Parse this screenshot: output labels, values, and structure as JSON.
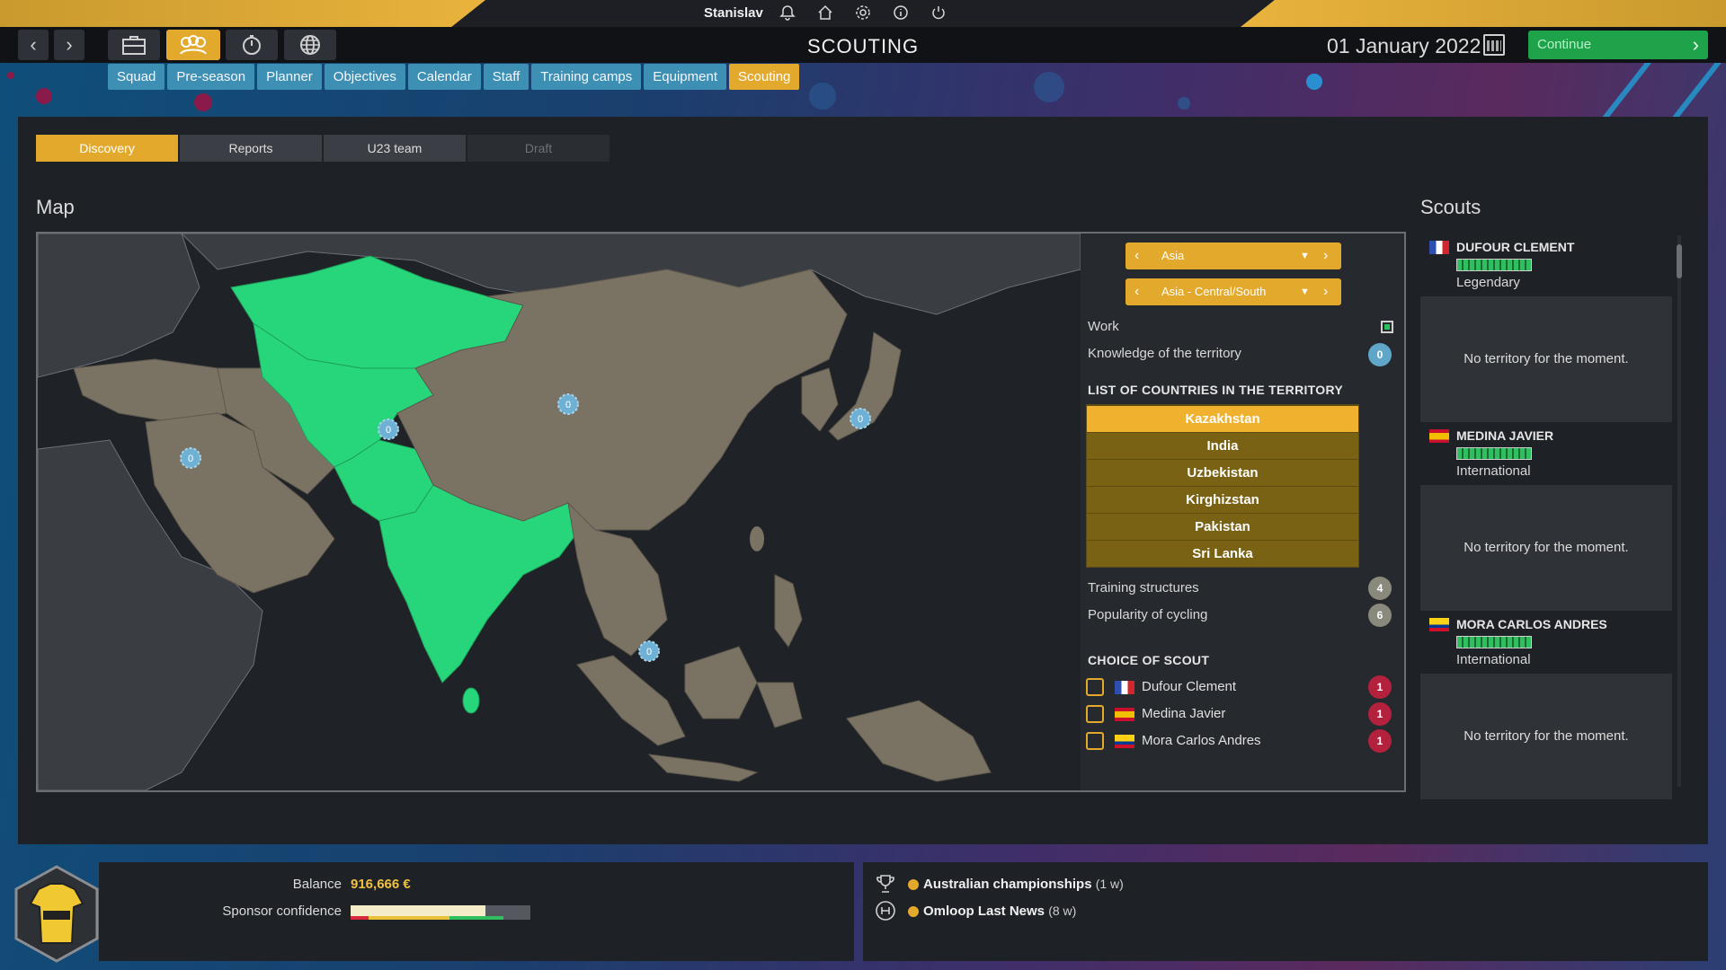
{
  "topbar": {
    "username": "Stanislav",
    "icons": [
      "bell-icon",
      "home-icon",
      "gear-icon",
      "info-icon",
      "power-icon"
    ]
  },
  "header": {
    "title": "SCOUTING",
    "date": "01 January 2022",
    "continue_label": "Continue"
  },
  "nav_icons": [
    "back-arrow-icon",
    "forward-arrow-icon",
    "briefcase-icon",
    "team-icon",
    "stopwatch-icon",
    "globe-icon"
  ],
  "module_tabs": [
    {
      "label": "Squad"
    },
    {
      "label": "Pre-season"
    },
    {
      "label": "Planner"
    },
    {
      "label": "Objectives"
    },
    {
      "label": "Calendar"
    },
    {
      "label": "Staff"
    },
    {
      "label": "Training camps"
    },
    {
      "label": "Equipment"
    },
    {
      "label": "Scouting"
    }
  ],
  "sub_tabs": [
    {
      "label": "Discovery"
    },
    {
      "label": "Reports"
    },
    {
      "label": "U23 team"
    },
    {
      "label": "Draft"
    }
  ],
  "map": {
    "heading": "Map",
    "markers": [
      "0",
      "0",
      "0",
      "0",
      "0"
    ]
  },
  "territory": {
    "continent": "Asia",
    "region": "Asia - Central/South",
    "work_label": "Work",
    "knowledge_label": "Knowledge of the territory",
    "knowledge_value": "0",
    "countries_heading": "LIST OF COUNTRIES IN THE TERRITORY",
    "countries": [
      "Kazakhstan",
      "India",
      "Uzbekistan",
      "Kirghizstan",
      "Pakistan",
      "Sri Lanka"
    ],
    "training_label": "Training structures",
    "training_value": "4",
    "popularity_label": "Popularity of cycling",
    "popularity_value": "6",
    "choice_heading": "CHOICE OF SCOUT",
    "scout_choices": [
      {
        "name": "Dufour Clement",
        "cost": "1"
      },
      {
        "name": "Medina Javier",
        "cost": "1"
      },
      {
        "name": "Mora Carlos Andres",
        "cost": "1"
      }
    ]
  },
  "scouts": {
    "heading": "Scouts",
    "list": [
      {
        "name": "DUFOUR CLEMENT",
        "level": "Legendary",
        "territory": "No territory for the moment."
      },
      {
        "name": "MEDINA JAVIER",
        "level": "International",
        "territory": "No territory for the moment."
      },
      {
        "name": "MORA CARLOS ANDRES",
        "level": "International",
        "territory": "No territory for the moment."
      }
    ]
  },
  "footer": {
    "balance_label": "Balance",
    "balance_value": "916,666 €",
    "sponsor_label": "Sponsor confidence",
    "sponsor_level": 0.75,
    "events": [
      {
        "name": "Australian championships",
        "duration": "(1 w)"
      },
      {
        "name": "Omloop Last News",
        "duration": "(8 w)"
      }
    ]
  },
  "colors": {
    "accent": "#e3a92d",
    "tab_blue": "#3d8fb4",
    "highlight_green": "#27d67a",
    "land": "#7a7263",
    "continue_green": "#1fa34a"
  }
}
